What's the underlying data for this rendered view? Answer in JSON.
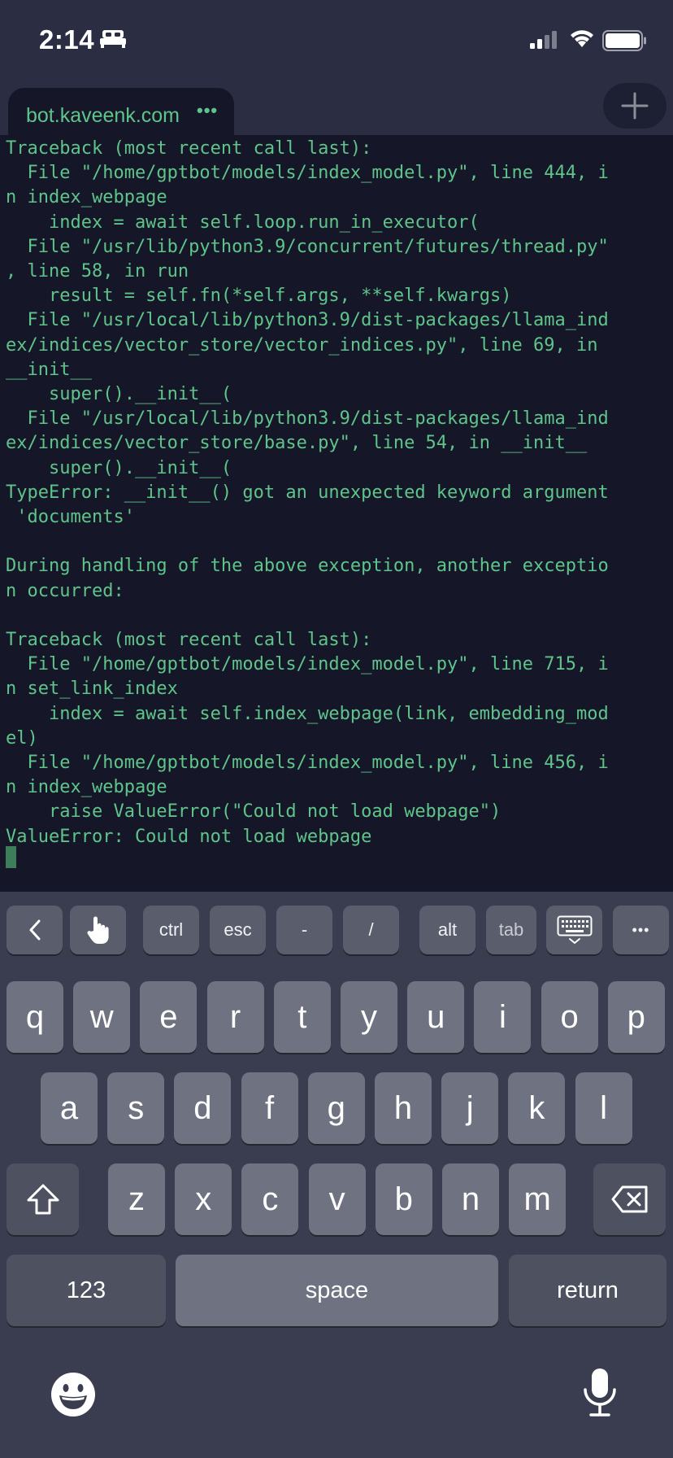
{
  "status_bar": {
    "time": "2:14",
    "sleep_icon": "bed-icon",
    "signal_icon": "cellular-signal-icon",
    "wifi_icon": "wifi-icon",
    "battery_icon": "battery-icon"
  },
  "browser": {
    "tab_title": "bot.kaveenk.com",
    "tab_more": "•••",
    "new_tab_icon": "plus-icon"
  },
  "terminal": {
    "text_color": "#5fc48a",
    "background": "#151728",
    "lines": [
      "Traceback (most recent call last):",
      "  File \"/home/gptbot/models/index_model.py\", line 444, i",
      "n index_webpage",
      "    index = await self.loop.run_in_executor(",
      "  File \"/usr/lib/python3.9/concurrent/futures/thread.py\"",
      ", line 58, in run",
      "    result = self.fn(*self.args, **self.kwargs)",
      "  File \"/usr/local/lib/python3.9/dist-packages/llama_ind",
      "ex/indices/vector_store/vector_indices.py\", line 69, in",
      "__init__",
      "    super().__init__(",
      "  File \"/usr/local/lib/python3.9/dist-packages/llama_ind",
      "ex/indices/vector_store/base.py\", line 54, in __init__",
      "    super().__init__(",
      "TypeError: __init__() got an unexpected keyword argument",
      " 'documents'",
      "",
      "During handling of the above exception, another exceptio",
      "n occurred:",
      "",
      "Traceback (most recent call last):",
      "  File \"/home/gptbot/models/index_model.py\", line 715, i",
      "n set_link_index",
      "    index = await self.index_webpage(link, embedding_mod",
      "el)",
      "  File \"/home/gptbot/models/index_model.py\", line 456, i",
      "n index_webpage",
      "    raise ValueError(\"Could not load webpage\")",
      "ValueError: Could not load webpage"
    ]
  },
  "accessory_bar": {
    "back_icon": "chevron-left-icon",
    "touch_icon": "hand-pointer-icon",
    "ctrl": "ctrl",
    "esc": "esc",
    "dash": "-",
    "slash": "/",
    "alt": "alt",
    "tab": "tab",
    "keyboard_icon": "keyboard-dismiss-icon",
    "more": "•••"
  },
  "keyboard": {
    "row1": [
      "q",
      "w",
      "e",
      "r",
      "t",
      "y",
      "u",
      "i",
      "o",
      "p"
    ],
    "row2": [
      "a",
      "s",
      "d",
      "f",
      "g",
      "h",
      "j",
      "k",
      "l"
    ],
    "row3": [
      "z",
      "x",
      "c",
      "v",
      "b",
      "n",
      "m"
    ],
    "shift_icon": "shift-icon",
    "delete_icon": "backspace-icon",
    "numbers": "123",
    "space": "space",
    "return": "return",
    "emoji_icon": "emoji-icon",
    "mic_icon": "microphone-icon"
  }
}
